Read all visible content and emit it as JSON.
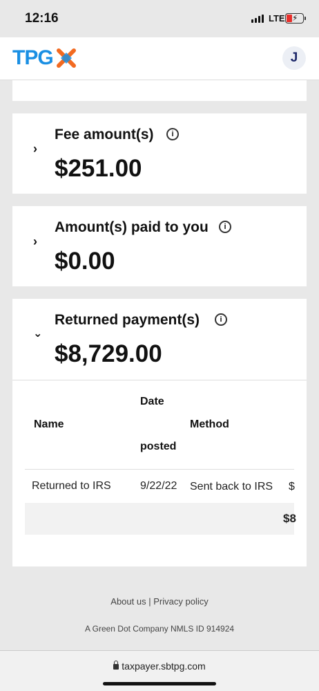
{
  "status_bar": {
    "time": "12:16",
    "network": "LTE"
  },
  "header": {
    "logo_text": "TPG",
    "avatar_initial": "J"
  },
  "cards": [
    {
      "title": "Fee amount(s)",
      "amount": "$251.00",
      "expanded": false
    },
    {
      "title": "Amount(s) paid to you",
      "amount": "$0.00",
      "expanded": false
    },
    {
      "title": "Returned payment(s)",
      "amount": "$8,729.00",
      "expanded": true
    }
  ],
  "returned_table": {
    "headers": {
      "name": "Name",
      "date_line1": "Date",
      "date_line2": "posted",
      "method": "Method"
    },
    "rows": [
      {
        "name": "Returned to IRS",
        "date": "9/22/22",
        "method": "Sent back to IRS",
        "amount_partial": "$"
      }
    ],
    "total_partial": "$8"
  },
  "footer": {
    "about": "About us",
    "separator": "|",
    "privacy": "Privacy policy",
    "company": "A Green Dot Company NMLS ID 914924"
  },
  "browser": {
    "url": "taxpayer.sbtpg.com"
  },
  "colors": {
    "brand_blue": "#1a8fe3",
    "brand_orange": "#f26a21",
    "battery_red": "#e8302c"
  }
}
